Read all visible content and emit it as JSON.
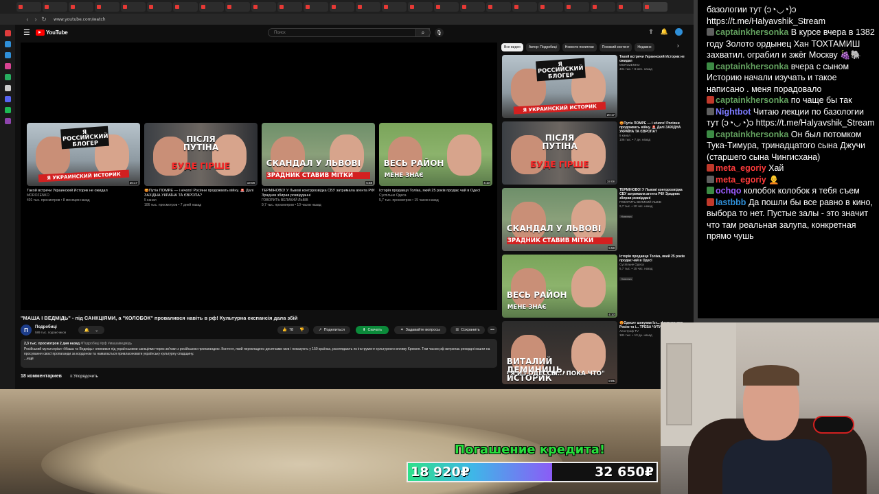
{
  "browser": {
    "url": "www.youtube.com/watch"
  },
  "header": {
    "logo_text": "YouTube",
    "search_placeholder": "Поиск"
  },
  "endscreen": [
    {
      "title": "Такой встречи Украинский Историк не ожидал",
      "channel": "MOROZENKO",
      "meta": "401 тыс. просмотров • 8 месяцев назад",
      "duration": "20:17",
      "banner_top": "Я РОССИЙСКИЙ БЛОГЕР",
      "banner_bottom": "Я УКРАИНСКИЙ ИСТОРИК"
    },
    {
      "title": "😡Путін ПОМРЕ — і нічого! Росіяни продожвать війну. 🚨 Далі ЗАХІДНА УКРАЇНА ТА ЄВРОПА?",
      "channel": "5 канал",
      "meta": "106 тыс. просмотров • 7 дней назад",
      "duration": "19:08",
      "banner_top": "ПІСЛЯ ПУТІНА",
      "banner_bottom": "БУДЕ ГІРШЕ"
    },
    {
      "title": "ТЕРМІНОВО! У Львові контррозвідка СБУ затримала агента РФ! Зрадник збирав розвідданні",
      "channel": "ГОВОРИТЬ ВЕЛИКИЙ ЛЬВІВ",
      "meta": "9,7 тыс. просмотров • 10 часов назад",
      "duration": "5:58",
      "banner_top": "СКАНДАЛ У ЛЬВОВІ",
      "banner_bottom": "ЗРАДНИК СТАВИВ МІТКИ"
    },
    {
      "title": "Історія продавця Толіка, який 25 років продає чай в Одесі",
      "channel": "Суспільне Одеса",
      "meta": "5,7 тыс. просмотров • 15 часов назад",
      "duration": "4:10",
      "banner_top": "ВЕСЬ РАЙОН",
      "banner_bottom": "МЕНЕ ЗНАЄ"
    }
  ],
  "video": {
    "title": "\"МАША І ВЕДМІДЬ\" - під САНКЦІЯМИ, а \"КОЛОБОК\" провалився навіть в рф! Культурна експансія дала збій",
    "channel": "Подробиці",
    "channel_initial": "П",
    "subscribers": "589 тыс. подписчиков",
    "likes": "78",
    "share_label": "Поделиться",
    "download_label": "Скачать",
    "ask_label": "Задавайте вопросы",
    "save_label": "Сохранить",
    "more_label": "•••",
    "views_date": "2,3 тыс. просмотров  2 дня назад",
    "tags": "#Подробиці #рф #машаіведмідь",
    "description": "Російський мультсеріал «Маша та Ведмідь» опинився під українськими санкціями через зв'язки з російською пропагандою. Контент, який перекладено десятками мов і показують у 150 країнах, розглядають як інструмент культурного впливу Кремля. Тим часом рф витрачає рекордні кошти на просування своєї пропаганди за кордоном та намагається привласнювати українську культурну спадщину.",
    "more": "...ещё"
  },
  "comments": {
    "count_label": "18 комментариев",
    "sort_label": "Упорядочить"
  },
  "chips": [
    "Все видео",
    "Автор: Подробиці",
    "Новости политики",
    "Похожий контент",
    "Недавно"
  ],
  "related": [
    {
      "title": "Такой встречи Украинский Историк не ожидал",
      "channel": "MOROZENKO",
      "meta": "401 тыс. • 8 мес. назад",
      "badge": "",
      "duration": "20:17",
      "banner_top": "Я РОССИЙСКИЙ БЛОГЕР",
      "banner_bottom": "Я УКРАИНСКИЙ ИСТОРИК"
    },
    {
      "title": "😡Путін ПОМРЕ — і нічого! Росіяни продожвать війну. 🚨 Далі ЗАХІДНА УКРАЇНА ТА ЄВРОПА?",
      "channel": "5 канал",
      "meta": "106 тыс. • 7 дн. назад",
      "badge": "",
      "duration": "19:08",
      "banner_top": "ПІСЛЯ ПУТІНА",
      "banner_bottom": "БУДЕ ГІРШЕ"
    },
    {
      "title": "ТЕРМІНОВО! У Львові контррозвідка СБУ затримала агента РФ! Зрадник збирав розвіддані",
      "channel": "ГОВОРИТЬ ВЕЛИКИЙ ЛЬВІВ",
      "meta": "9,7 тыс. • 10 час. назад",
      "badge": "Новинка",
      "duration": "5:58",
      "banner_top": "СКАНДАЛ У ЛЬВОВІ",
      "banner_bottom": "ЗРАДНИК СТАВИВ МІТКИ"
    },
    {
      "title": "Історія продавця Толіка, який 25 років продає чай в Одесі",
      "channel": "Суспільне Одеса",
      "meta": "5,7 тыс. • 15 час. назад",
      "badge": "Новинка",
      "duration": "4:10",
      "banner_top": "ВЕСЬ РАЙОН",
      "banner_bottom": "МЕНЕ ЗНАЄ"
    },
    {
      "title": "😡Одесит шокував Іст... фактами про Росію та і... ТРЕБА ЧУТИ",
      "channel": "Апостроф TV",
      "meta": "181 тыс. • 13 дн. назад",
      "badge": "",
      "duration": "8:05",
      "banner_top": "ВИТАЛИЙ ДЕМИНИЦЬ, ИСТОРИК",
      "banner_bottom": "\"Я ИЗ ОДЕССЫ... ПОКА ЧТО\""
    }
  ],
  "chat": [
    {
      "user": "",
      "text": "базологии тут (ↄ◔◡◔)ↄ",
      "color": "#ffffff"
    },
    {
      "user": "",
      "text": "https://t.me/Halyavshik_Stream",
      "color": "#ffffff"
    },
    {
      "user": "captainkhersonka",
      "text": "В курсе вчера в 1382 году Золото ордынец Хан ТОХТАМИШ захватил. ограбил и зжёг Москву 🍇🐘",
      "color": "#63a15f"
    },
    {
      "user": "captainkhersonka",
      "text": "вчера с сыном Историю начали изучать и такое написано . меня порадовало",
      "color": "#63a15f"
    },
    {
      "user": "captainkhersonka",
      "text": "по чаще бы так",
      "color": "#63a15f"
    },
    {
      "user": "Nightbot",
      "text": "Читаю лекции по базологии тут (ↄ◔◡◔)ↄ https://t.me/Halyavshik_Stream",
      "color": "#7c7bff"
    },
    {
      "user": "captainkhersonka",
      "text": "Он был потомком Тука-Тимура, тринадцатого сына Джучи (старшего сына Чингисхана)",
      "color": "#63a15f"
    },
    {
      "user": "meta_egoriy",
      "text": "Хай",
      "color": "#ff3b3b"
    },
    {
      "user": "meta_egoriy",
      "text": "🧑‍🦲",
      "color": "#ff3b3b"
    },
    {
      "user": "ochqo",
      "text": "колобок колобок я тебя съем",
      "color": "#9b5cff"
    },
    {
      "user": "lastbbb",
      "text": "Да пошли бы все равно в кино, выбора то нет. Пустые залы - это значит что там реальная залупа, конкретная прямо чушь",
      "color": "#2f8fd8"
    }
  ],
  "goal": {
    "title": "Погашение кредита!",
    "current": "18 920₽",
    "target": "32 650₽",
    "progress_fraction": 0.58
  },
  "colors": {
    "yt_bg": "#0f0f0f",
    "yt_red": "#ff0000",
    "goal_green": "#27e03c",
    "download_green": "#0b8a3a"
  }
}
